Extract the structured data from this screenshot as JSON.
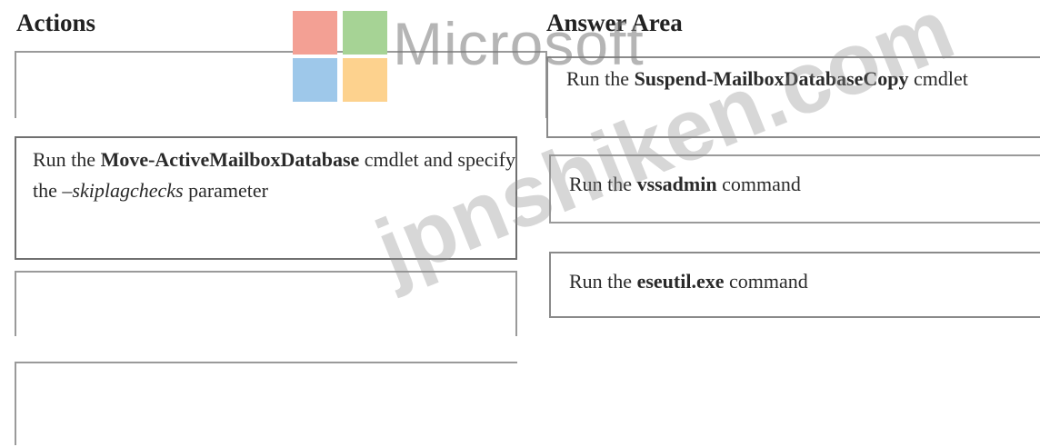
{
  "headings": {
    "actions": "Actions",
    "answer_area": "Answer Area"
  },
  "actions": {
    "item1": {
      "prefix": "Run the ",
      "command": "Move-ActiveMailboxDatabase",
      "middle": " cmdlet and specify the ",
      "param": "–skiplagchecks",
      "suffix": " parameter"
    }
  },
  "answer_area": {
    "item1": {
      "prefix": "Run the ",
      "command": "Suspend-MailboxDatabaseCopy",
      "suffix": " cmdlet"
    },
    "item2": {
      "prefix": "Run the ",
      "command": "vssadmin",
      "suffix": " command"
    },
    "item3": {
      "prefix": "Run the ",
      "command": "eseutil.exe",
      "suffix": " command"
    }
  },
  "watermarks": {
    "logo_text": "Microsoft",
    "site": "jpnshiken.com"
  },
  "colors": {
    "tile_red": "#f3a094",
    "tile_green": "#a6d395",
    "tile_blue": "#9ec8ea",
    "tile_yellow": "#fdd28e"
  }
}
